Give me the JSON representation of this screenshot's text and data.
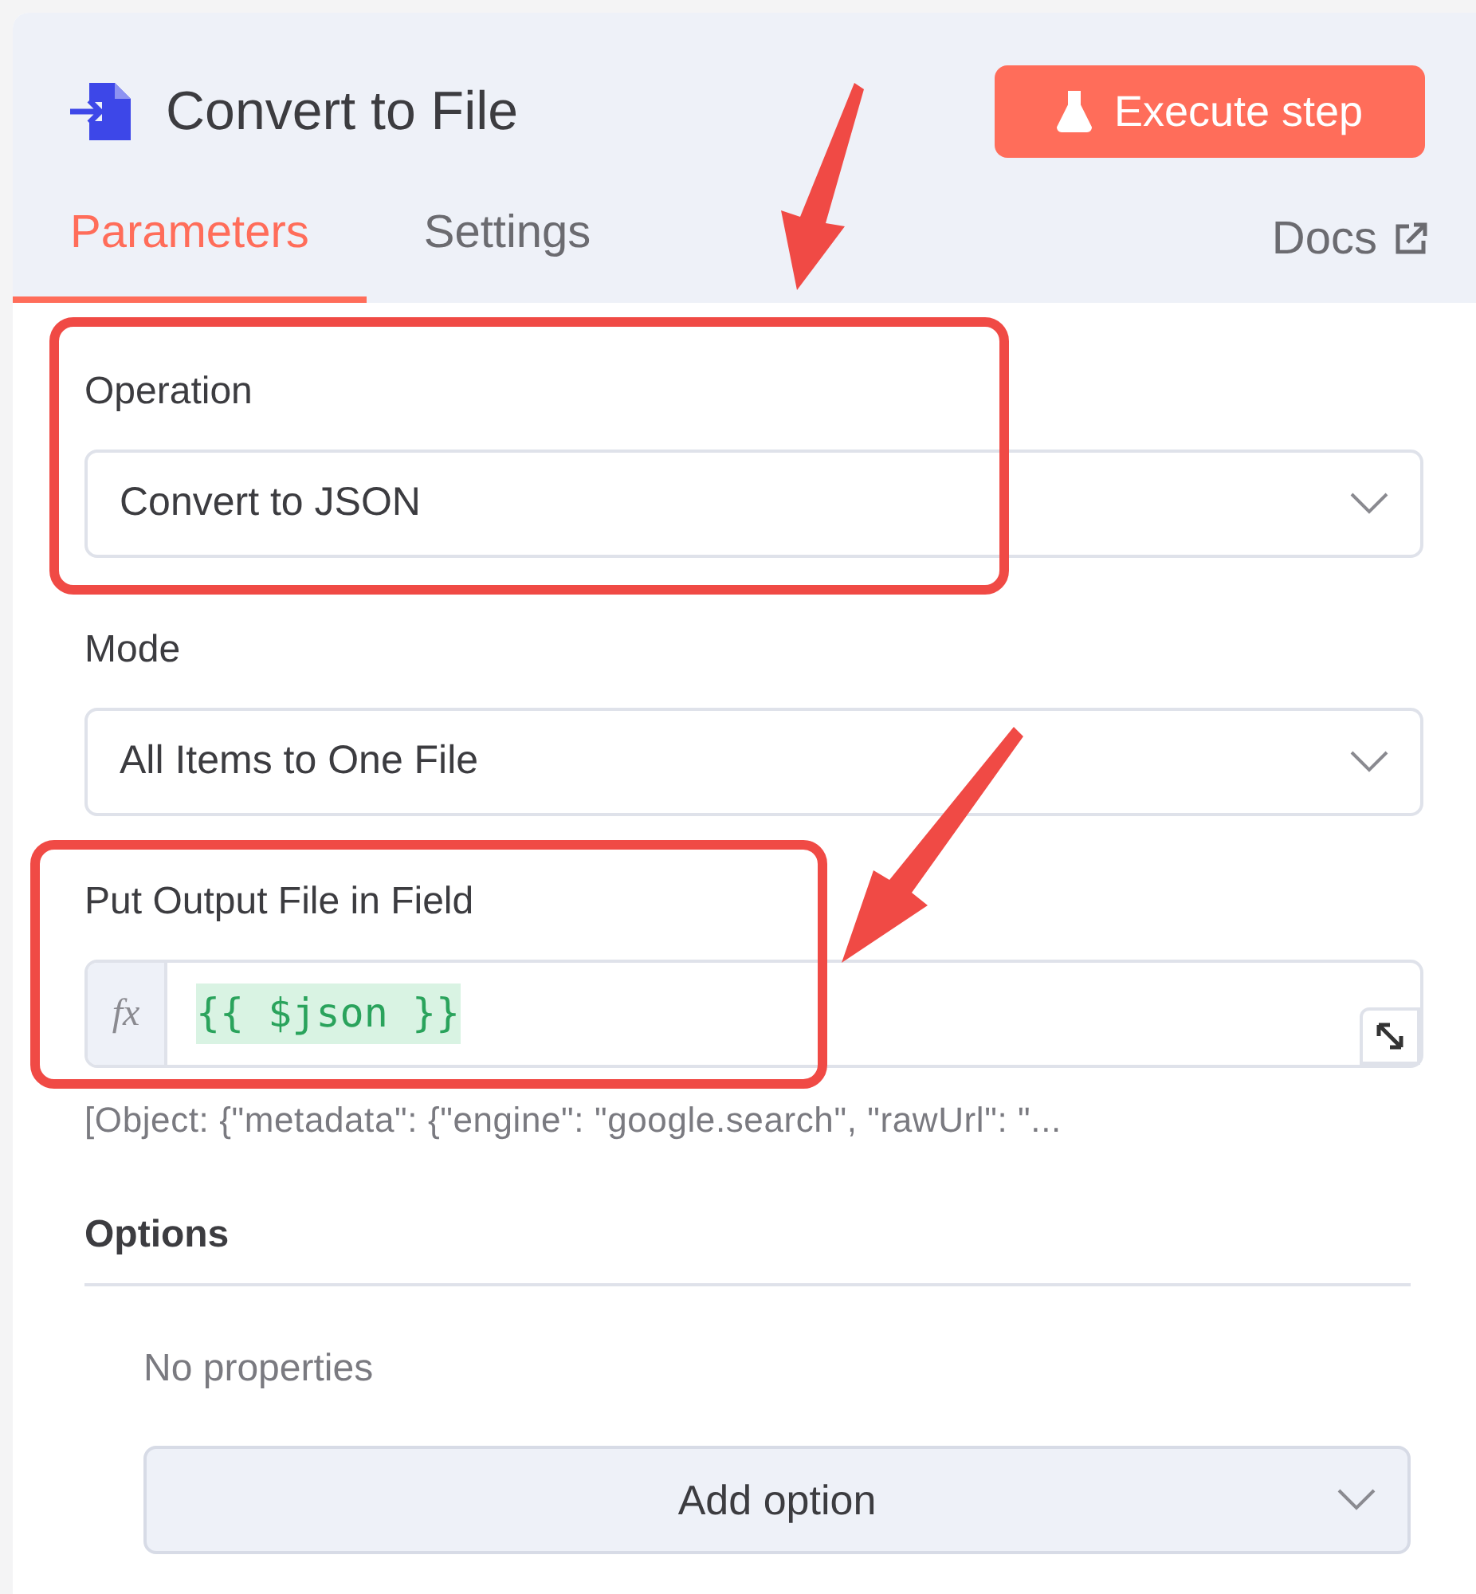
{
  "node": {
    "title": "Convert to File"
  },
  "execute_button": {
    "label": "Execute step"
  },
  "tabs": [
    {
      "label": "Parameters",
      "selected": true
    },
    {
      "label": "Settings",
      "selected": false
    }
  ],
  "docs_link": {
    "label": "Docs"
  },
  "fields": [
    {
      "kind": "select",
      "label": "Operation",
      "value": "Convert to JSON"
    },
    {
      "kind": "select",
      "label": "Mode",
      "value": "All Items to One File"
    },
    {
      "kind": "expression",
      "label": "Put Output File in Field",
      "prefix": "fx",
      "value": "{{ $json }}",
      "hint": "[Object: {\"metadata\": {\"engine\": \"google.search\", \"rawUrl\": \"..."
    }
  ],
  "options": {
    "title": "Options",
    "empty_text": "No properties",
    "add_button": "Add option"
  }
}
